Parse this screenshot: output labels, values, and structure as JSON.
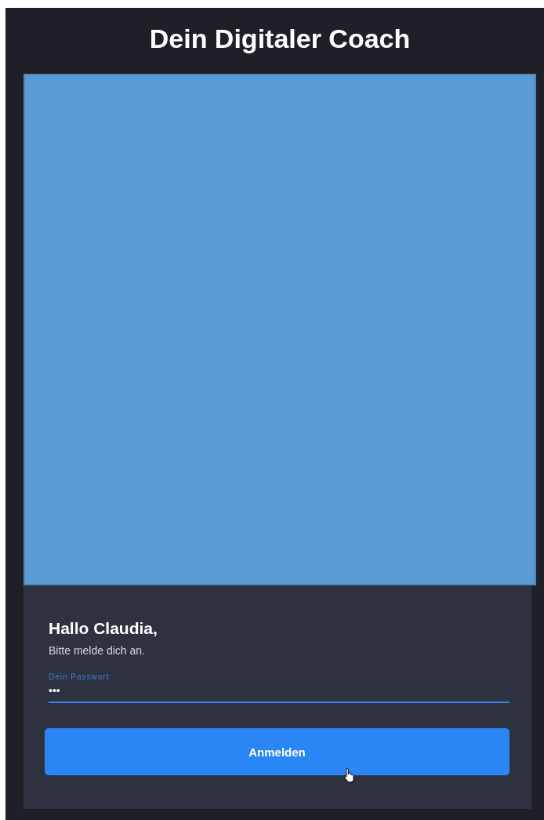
{
  "header": {
    "title": "Dein Digitaler Coach"
  },
  "login": {
    "greeting": "Hallo Claudia,",
    "subtitle": "Bitte melde dich an.",
    "password_field": {
      "label": "Dein Passwort",
      "value": "•••",
      "focused": true
    },
    "button": "Anmelden"
  }
}
